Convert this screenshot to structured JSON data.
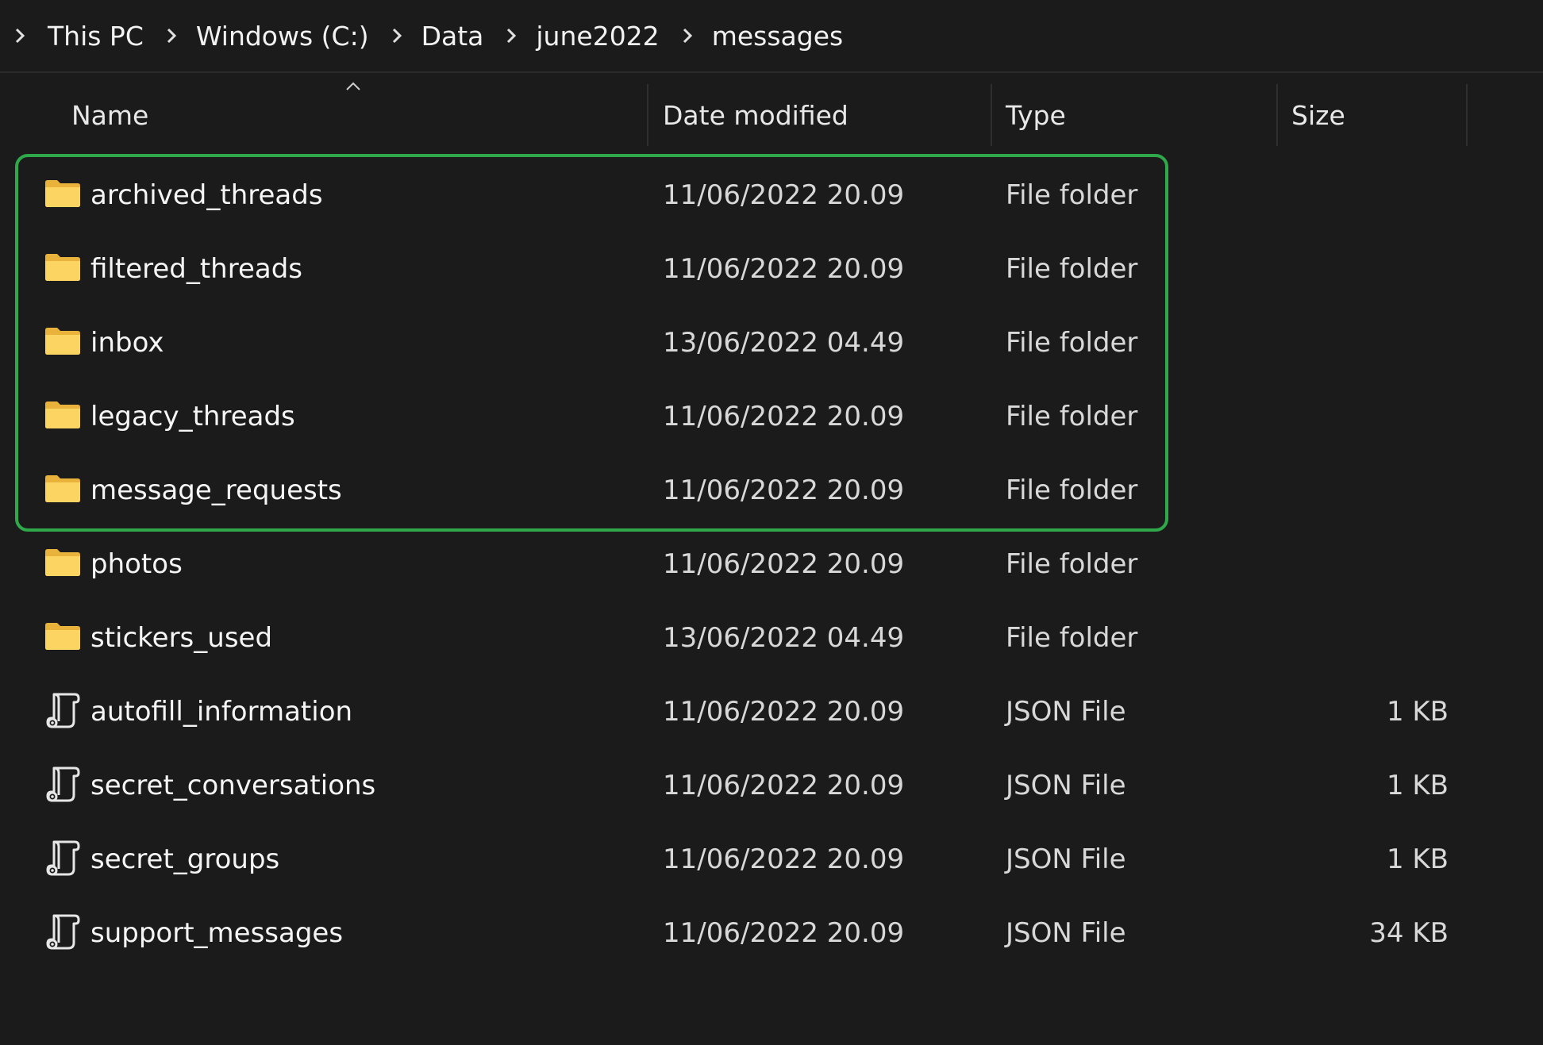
{
  "breadcrumb": {
    "items": [
      {
        "label": "This PC"
      },
      {
        "label": "Windows (C:)"
      },
      {
        "label": "Data"
      },
      {
        "label": "june2022"
      },
      {
        "label": "messages"
      }
    ]
  },
  "columns": {
    "name": "Name",
    "date": "Date modified",
    "type": "Type",
    "size": "Size",
    "sorted_by": "name",
    "sort_direction": "ascending"
  },
  "rows": [
    {
      "icon": "folder-icon",
      "name": "archived_threads",
      "date": "11/06/2022 20.09",
      "type": "File folder",
      "size": ""
    },
    {
      "icon": "folder-icon",
      "name": "filtered_threads",
      "date": "11/06/2022 20.09",
      "type": "File folder",
      "size": ""
    },
    {
      "icon": "folder-icon",
      "name": "inbox",
      "date": "13/06/2022 04.49",
      "type": "File folder",
      "size": ""
    },
    {
      "icon": "folder-icon",
      "name": "legacy_threads",
      "date": "11/06/2022 20.09",
      "type": "File folder",
      "size": ""
    },
    {
      "icon": "folder-icon",
      "name": "message_requests",
      "date": "11/06/2022 20.09",
      "type": "File folder",
      "size": ""
    },
    {
      "icon": "folder-icon",
      "name": "photos",
      "date": "11/06/2022 20.09",
      "type": "File folder",
      "size": ""
    },
    {
      "icon": "folder-icon",
      "name": "stickers_used",
      "date": "13/06/2022 04.49",
      "type": "File folder",
      "size": ""
    },
    {
      "icon": "json-file-icon",
      "name": "autofill_information",
      "date": "11/06/2022 20.09",
      "type": "JSON File",
      "size": "1 KB"
    },
    {
      "icon": "json-file-icon",
      "name": "secret_conversations",
      "date": "11/06/2022 20.09",
      "type": "JSON File",
      "size": "1 KB"
    },
    {
      "icon": "json-file-icon",
      "name": "secret_groups",
      "date": "11/06/2022 20.09",
      "type": "JSON File",
      "size": "1 KB"
    },
    {
      "icon": "json-file-icon",
      "name": "support_messages",
      "date": "11/06/2022 20.09",
      "type": "JSON File",
      "size": "34 KB"
    }
  ],
  "colors": {
    "background": "#1b1b1b",
    "highlight": "#2ea84a",
    "folder": "#f7c948"
  }
}
